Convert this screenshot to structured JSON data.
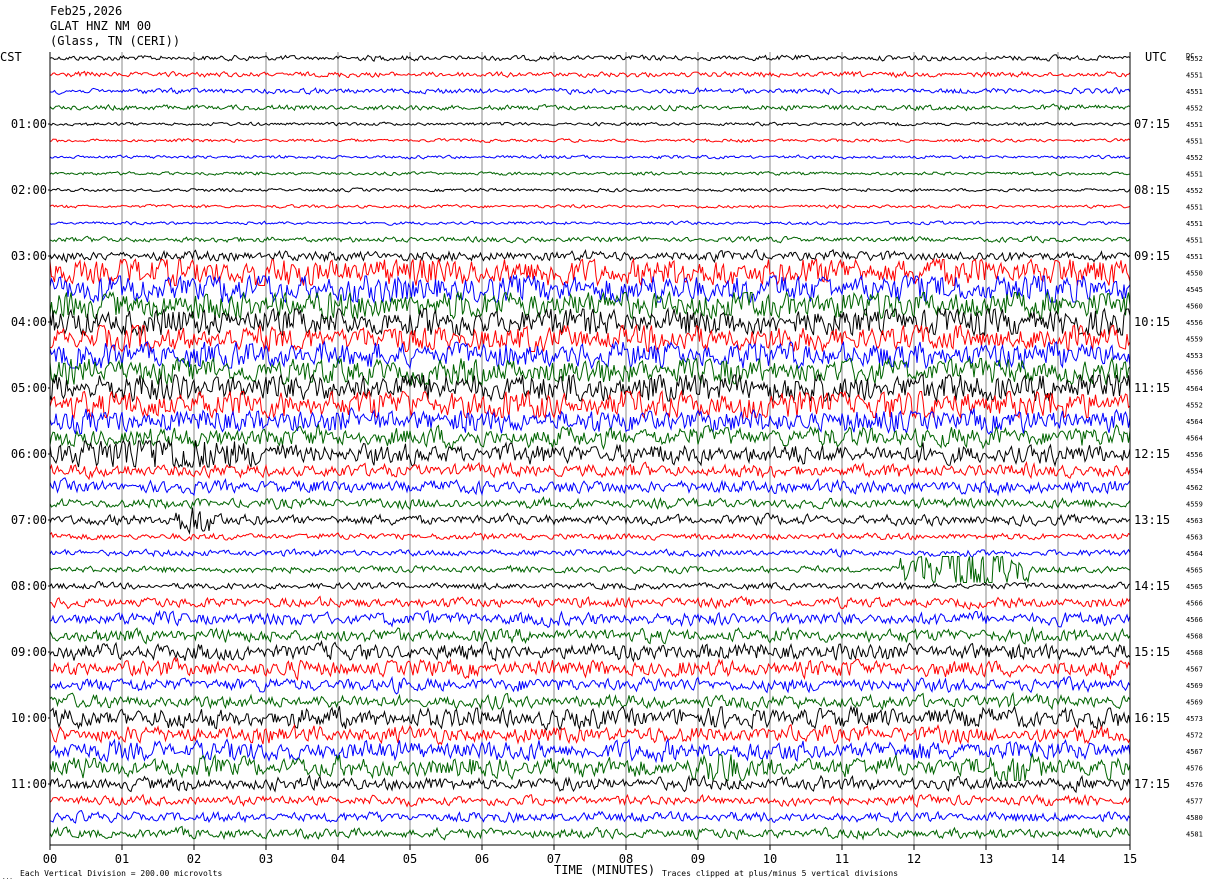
{
  "header": {
    "date": "Feb25,2026",
    "station": "GLAT HNZ NM 00",
    "location": "(Glass, TN (CERI))"
  },
  "labels": {
    "left_zone": "CST",
    "right_zone": "UTC",
    "dc_label": "DC",
    "x_title": "TIME (MINUTES)",
    "scale_note": "Each Vertical Division =  200.00 microvolts",
    "clip_note": "Traces clipped at plus/minus 5 vertical divisions",
    "corner_mark": "..."
  },
  "colors": {
    "trace_cycle": [
      "#000000",
      "#ff0000",
      "#0000ff",
      "#006400"
    ],
    "grid": "#888888",
    "frame": "#000000"
  },
  "chart_data": {
    "type": "line",
    "title": "GLAT HNZ NM 00",
    "xlabel": "TIME (MINUTES)",
    "xlim": [
      0,
      15
    ],
    "x_ticks": [
      "00",
      "01",
      "02",
      "03",
      "04",
      "05",
      "06",
      "07",
      "08",
      "09",
      "10",
      "11",
      "12",
      "13",
      "14",
      "15"
    ],
    "trace_count": 48,
    "left_time_labels": [
      "01:00",
      "02:00",
      "03:00",
      "04:00",
      "05:00",
      "06:00",
      "07:00",
      "08:00",
      "09:00",
      "10:00",
      "11:00"
    ],
    "right_time_labels": [
      "07:15",
      "08:15",
      "09:15",
      "10:15",
      "11:15",
      "12:15",
      "13:15",
      "14:15",
      "15:15",
      "16:15",
      "17:15"
    ],
    "dc_offsets": [
      "4552",
      "4551",
      "4551",
      "4552",
      "4551",
      "4551",
      "4552",
      "4551",
      "4552",
      "4551",
      "4551",
      "4551",
      "4551",
      "4550",
      "4545",
      "4560",
      "4556",
      "4559",
      "4553",
      "4556",
      "4564",
      "4552",
      "4564",
      "4564",
      "4556",
      "4554",
      "4562",
      "4559",
      "4563",
      "4563",
      "4564",
      "4565",
      "4565",
      "4566",
      "4566",
      "4568",
      "4568",
      "4567",
      "4569",
      "4569",
      "4573",
      "4572",
      "4567",
      "4576",
      "4576",
      "4577",
      "4580",
      "4581"
    ],
    "amplitude_levels": [
      0.8,
      0.8,
      0.8,
      0.8,
      0.5,
      0.5,
      0.5,
      0.5,
      0.5,
      0.5,
      0.5,
      0.8,
      1.5,
      4.5,
      4.5,
      4.5,
      4.5,
      4.0,
      4.0,
      4.0,
      4.5,
      4.5,
      3.5,
      3.0,
      3.0,
      2.0,
      2.0,
      1.5,
      1.5,
      1.0,
      1.0,
      1.0,
      1.0,
      1.5,
      2.0,
      2.0,
      2.5,
      2.5,
      2.0,
      2.0,
      3.0,
      2.5,
      3.0,
      3.0,
      2.0,
      1.5,
      1.5,
      1.5
    ],
    "events": [
      {
        "trace": 31,
        "start_min": 11.8,
        "end_min": 13.6,
        "amplitude": 5
      },
      {
        "trace": 28,
        "start_min": 1.6,
        "end_min": 2.4,
        "amplitude": 3
      },
      {
        "trace": 43,
        "start_min": 8.9,
        "end_min": 9.7,
        "amplitude": 4
      },
      {
        "trace": 43,
        "start_min": 13.0,
        "end_min": 13.8,
        "amplitude": 4
      },
      {
        "trace": 24,
        "start_min": 0.0,
        "end_min": 3.2,
        "amplitude": 4
      }
    ],
    "scale_microvolts_per_division": 200.0,
    "clip_divisions": 5
  }
}
